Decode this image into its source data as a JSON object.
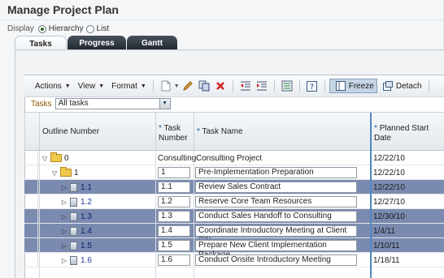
{
  "page": {
    "title": "Manage Project Plan"
  },
  "display": {
    "label": "Display",
    "options": [
      {
        "label": "Hierarchy",
        "selected": true
      },
      {
        "label": "List",
        "selected": false
      }
    ]
  },
  "tabs": [
    {
      "label": "Tasks",
      "active": true
    },
    {
      "label": "Progress",
      "active": false
    },
    {
      "label": "Gantt",
      "active": false
    }
  ],
  "toolbar": {
    "menus": [
      {
        "label": "Actions"
      },
      {
        "label": "View"
      },
      {
        "label": "Format"
      }
    ],
    "freeze_label": "Freeze",
    "detach_label": "Detach",
    "icons": [
      "new-document-icon",
      "edit-pencil-icon",
      "copy-task-icon",
      "delete-icon",
      "outdent-icon",
      "indent-icon",
      "export-icon",
      "help-icon",
      "freeze-icon",
      "detach-icon"
    ]
  },
  "filter": {
    "label": "Tasks",
    "value": "All tasks"
  },
  "table": {
    "required_mark": "*",
    "columns": {
      "outline": "Outline Number",
      "task_number": "Task Number",
      "task_name": "Task Name",
      "planned_start": "Planned Start Date"
    },
    "rows": [
      {
        "outline": "0",
        "level": 0,
        "type": "folder",
        "expander": "▽",
        "task_number": "Consulting",
        "task_name": "Consulting Project",
        "editable": false,
        "start": "12/22/10",
        "selected": false
      },
      {
        "outline": "1",
        "level": 1,
        "type": "folder",
        "expander": "▽",
        "task_number": "1",
        "task_name": "Pre-Implementation Preparation",
        "editable": true,
        "start": "12/22/10",
        "selected": false
      },
      {
        "outline": "1.1",
        "level": 2,
        "type": "task",
        "expander": "▷",
        "task_number": "1.1",
        "task_name": "Review Sales Contract",
        "editable": true,
        "start": "12/22/10",
        "selected": true
      },
      {
        "outline": "1.2",
        "level": 2,
        "type": "task",
        "expander": "▷",
        "task_number": "1.2",
        "task_name": "Reserve Core Team Resources",
        "editable": true,
        "start": "12/27/10",
        "selected": false
      },
      {
        "outline": "1.3",
        "level": 2,
        "type": "task",
        "expander": "▷",
        "task_number": "1.3",
        "task_name": "Conduct Sales Handoff to Consulting",
        "editable": true,
        "start": "12/30/10",
        "selected": true
      },
      {
        "outline": "1.4",
        "level": 2,
        "type": "task",
        "expander": "▷",
        "task_number": "1.4",
        "task_name": "Coordinate Introductory Meeting at Client Site",
        "editable": true,
        "start": "1/4/11",
        "selected": true
      },
      {
        "outline": "1.5",
        "level": 2,
        "type": "task",
        "expander": "▷",
        "task_number": "1.5",
        "task_name": "Prepare New Client Implementation Package",
        "editable": true,
        "start": "1/10/11",
        "selected": true
      },
      {
        "outline": "1.6",
        "level": 2,
        "type": "task",
        "expander": "▷",
        "task_number": "1.6",
        "task_name": "Conduct Onsite Introductory Meeting",
        "editable": true,
        "start": "1/18/11",
        "selected": false
      }
    ]
  },
  "colors": {
    "selected_row": "#7b8bb0",
    "tab_dark": "#2b333b",
    "required_star": "#1d5a9a",
    "link": "#1e3f9a"
  }
}
